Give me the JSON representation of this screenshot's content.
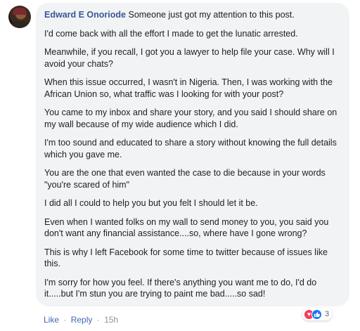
{
  "comment": {
    "author": "Edward E Onoriode",
    "first_line": "Someone just got my attention to this post.",
    "paragraphs": [
      "I'd come back with all the effort I made to get the lunatic arrested.",
      "Meanwhile, if you recall, I got you a lawyer to help file your case. Why will I avoid your chats?",
      "When this issue occurred, I wasn't in Nigeria. Then, I was working with the African Union so, what traffic was I looking for with your post?",
      "You came to my inbox and share your story, and you said I should share on my wall because of my wide audience which I did.",
      "I'm too sound and educated to share a story without knowing the full details which you gave me.",
      "You are the one that even wanted the case to die because in your words \"you're scared of him\"",
      "I did all I could to help you but you felt I should let it be.",
      "Even when I wanted folks on my wall to send money to you, you said you don't want any financial assistance....so, where have I gone wrong?",
      "This is why I left Facebook for some time to twitter because of issues like this.",
      "I'm sorry for how you feel. If there's anything you want me to do, I'd do it.....but I'm stun you are trying to paint me bad.....so sad!"
    ]
  },
  "reactions": {
    "count": "3",
    "icons": [
      "love-icon",
      "like-icon"
    ],
    "love_color": "#f33e58",
    "like_color": "#1877f2"
  },
  "actions": {
    "like": "Like",
    "reply": "Reply",
    "separator": "·",
    "time": "15h"
  },
  "colors": {
    "author": "#385898",
    "bubble": "#f2f3f5",
    "link": "#4267b2"
  }
}
